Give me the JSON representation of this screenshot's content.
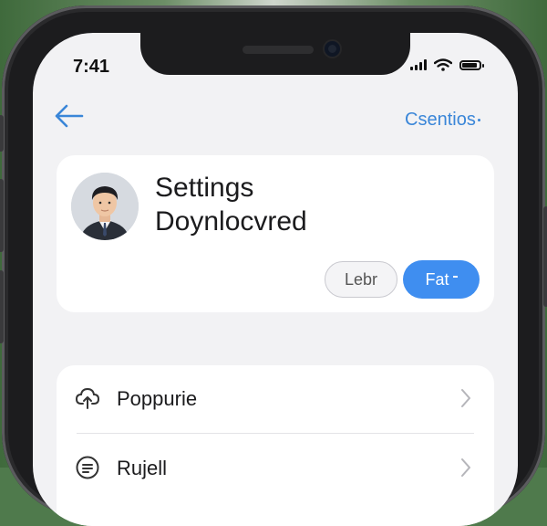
{
  "status_bar": {
    "time": "7:41",
    "icons": [
      "signal-icon",
      "wifi-icon",
      "battery-icon"
    ]
  },
  "nav": {
    "back_icon": "arrow-left-icon",
    "title": "Csentios"
  },
  "profile": {
    "title": "Settings",
    "subtitle": "Doynlocvred",
    "secondary_button": "Lebr",
    "primary_button": "Fat"
  },
  "list": {
    "items": [
      {
        "label": "Poppurie",
        "icon": "upload-cloud-icon"
      },
      {
        "label": "Rujell",
        "icon": "list-circle-icon"
      }
    ]
  },
  "colors": {
    "accent": "#3a86d8",
    "primary_button": "#3f8ef0",
    "screen_background": "#f2f2f4",
    "card_background": "#ffffff"
  }
}
